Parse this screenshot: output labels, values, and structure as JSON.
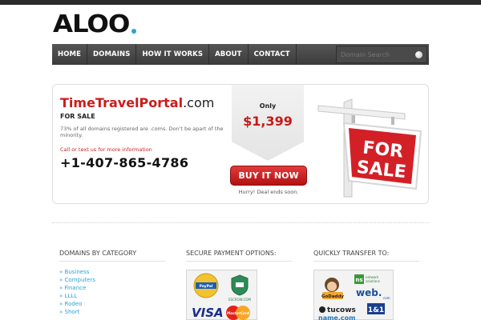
{
  "logo": {
    "text": "ALOO"
  },
  "nav": {
    "items": [
      {
        "label": "HOME"
      },
      {
        "label": "DOMAINS"
      },
      {
        "label": "HOW IT WORKS"
      },
      {
        "label": "ABOUT"
      },
      {
        "label": "CONTACT"
      }
    ],
    "search_placeholder": "Domain Search"
  },
  "sale": {
    "domain_name": "TimeTravelPortal",
    "domain_tld": ".com",
    "for_sale": "FOR SALE",
    "blurb": "73% of all domains registered are .coms. Don't be apart of the minority.",
    "call_text": "Call or text us for more information",
    "phone": "+1-407-865-4786",
    "only_label": "Only",
    "price": "$1,399",
    "buy_label": "BUY IT NOW",
    "deal_text": "Hurry! Deal ends soon.",
    "sign_line1": "FOR",
    "sign_line2": "SALE"
  },
  "footer": {
    "categories_title": "DOMAINS BY CATEGORY",
    "categories": [
      "Business",
      "Computers",
      "Finance",
      "LLLL",
      "Rodeo",
      "Short"
    ],
    "category_bullet": "»",
    "payment_title": "SECURE PAYMENT OPTIONS:",
    "payment_logos": [
      "PayPal VERIFIED",
      "ESCROW.COM",
      "VISA",
      "MasterCard"
    ],
    "transfer_title": "QUICKLY TRANSFER TO:",
    "transfer_logos": [
      "GoDaddy.com",
      "network solutions",
      "web.com",
      "tucows",
      "1&1",
      "name.com"
    ]
  },
  "colors": {
    "accent_blue": "#2aa3d8",
    "brand_red": "#cc1b1b",
    "nav_bg": "#444444"
  }
}
